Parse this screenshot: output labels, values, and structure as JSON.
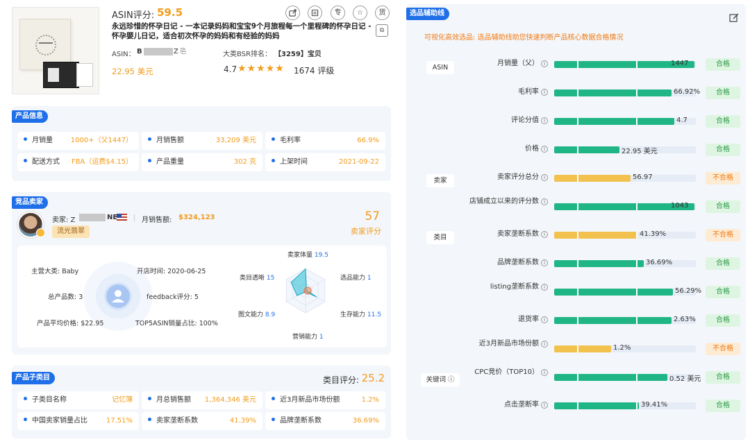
{
  "product": {
    "asin_score_label": "ASIN评分:",
    "asin_score": "59.5",
    "action_icons": [
      "share-icon",
      "calendar-icon",
      "专",
      "star-icon",
      "货"
    ],
    "action_labels": [
      "",
      "",
      "专",
      "☆",
      "货"
    ],
    "title": "永远珍惜的怀孕日记 - 一本记录妈妈和宝宝9个月旅程每一个里程碑的怀孕日记 - 怀孕婴儿日记，适合初次怀孕的妈妈和有经验的妈妈",
    "asin_label": "ASIN：",
    "asin_prefix": "B",
    "asin_suffix": "Z ⎘",
    "bsr_label": "大类BSR排名：",
    "bsr_value": "【3259】宝贝",
    "price": "22.95 美元",
    "rating": "4.7",
    "stars": "★★★★★",
    "reviews": "1674 评级"
  },
  "product_info": {
    "tag": "产品信息",
    "cells": [
      {
        "key": "月销量",
        "value": "1000+（父1447）"
      },
      {
        "key": "月销售额",
        "value": "33,209 美元"
      },
      {
        "key": "毛利率",
        "value": "66.9%"
      },
      {
        "key": "配送方式",
        "value": "FBA（运费$4.15）"
      },
      {
        "key": "产品重量",
        "value": "302 克"
      },
      {
        "key": "上架时间",
        "value": "2021-09-22"
      }
    ]
  },
  "seller": {
    "tag": "竞品卖家",
    "seller_label": "卖家: Z",
    "seller_suffix": "NE",
    "monthly_sales_label": "月销售额:",
    "monthly_sales": "$324,123",
    "level": "流光翡翠",
    "score": "57",
    "score_label": "卖家评分",
    "stats": [
      "主营大类: Baby",
      "开店时间: 2020-06-25",
      "总产品数: 3",
      "feedback评分: 5",
      "产品平均价格: $22.95",
      "TOP5ASIN销量占比: 100%"
    ],
    "radar": [
      {
        "label": "卖家体量",
        "value": 19.5
      },
      {
        "label": "选品能力",
        "value": 1
      },
      {
        "label": "生存能力",
        "value": 11.5
      },
      {
        "label": "营销能力",
        "value": 1
      },
      {
        "label": "图文能力",
        "value": 8.9
      },
      {
        "label": "类目透晰",
        "value": 15
      }
    ]
  },
  "subcategory": {
    "tag": "产品子类目",
    "score_label": "类目评分:",
    "score": "25.2",
    "cells": [
      {
        "key": "子类目名称",
        "value": "记忆簿"
      },
      {
        "key": "月总销售额",
        "value": "1,364,346 美元"
      },
      {
        "key": "近3月新品市场份额",
        "value": "1.2%"
      },
      {
        "key": "中国卖家销量占比",
        "value": "17.51%"
      },
      {
        "key": "卖家垄断系数",
        "value": "41.39%"
      },
      {
        "key": "品牌垄断系数",
        "value": "36.69%"
      }
    ]
  },
  "selection": {
    "tag": "选品辅助线",
    "subtitle": "可视化高效选品: 选品辅助线助您快速判断产品核心数据合格情况",
    "groups": [
      "ASIN",
      "卖家",
      "类目",
      "关键词 ⓘ"
    ],
    "colors": {
      "pass": "#1fb585",
      "fail": "#f2c14e"
    },
    "metrics": [
      {
        "label": "月销量（父）",
        "value": "1447",
        "fill": 0.99,
        "status": "合格",
        "pass": true
      },
      {
        "label": "毛利率",
        "value": "66.92%",
        "fill": 0.83,
        "status": "合格",
        "pass": true
      },
      {
        "label": "评论分值",
        "value": "4.7",
        "fill": 0.85,
        "status": "合格",
        "pass": true
      },
      {
        "label": "价格",
        "value": "22.95 美元",
        "fill": 0.46,
        "status": "合格",
        "pass": true
      },
      {
        "label": "卖家评分总分",
        "value": "56.97",
        "fill": 0.54,
        "status": "不合格",
        "pass": false
      },
      {
        "label": "店铺成立以来的评分数",
        "value": "1043",
        "fill": 0.99,
        "status": "合格",
        "pass": true
      },
      {
        "label": "卖家垄断系数",
        "value": "41.39%",
        "fill": 0.59,
        "status": "不合格",
        "pass": false
      },
      {
        "label": "品牌垄断系数",
        "value": "36.69%",
        "fill": 0.63,
        "status": "合格",
        "pass": true
      },
      {
        "label": "listing垄断系数",
        "value": "56.29%",
        "fill": 0.84,
        "status": "合格",
        "pass": true
      },
      {
        "label": "退货率",
        "value": "2.63%",
        "fill": 0.83,
        "status": "合格",
        "pass": true
      },
      {
        "label": "近3月新品市场份额",
        "value": "1.2%",
        "fill": 0.4,
        "status": "不合格",
        "pass": false
      },
      {
        "label": "CPC竞价（TOP10）",
        "value": "0.52 美元",
        "fill": 0.8,
        "status": "合格",
        "pass": true
      },
      {
        "label": "点击垄断率",
        "value": "39.41%",
        "fill": 0.6,
        "status": "合格",
        "pass": true
      }
    ]
  }
}
